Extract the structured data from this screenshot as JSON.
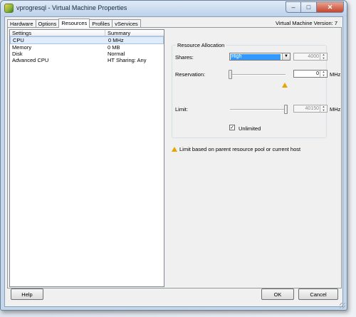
{
  "window": {
    "title": "vprogresql - Virtual Machine Properties",
    "controls": {
      "minimize": "–",
      "maximize": "□",
      "close": "✕"
    }
  },
  "tabs": [
    {
      "label": "Hardware"
    },
    {
      "label": "Options"
    },
    {
      "label": "Resources",
      "active": true
    },
    {
      "label": "Profiles"
    },
    {
      "label": "vServices"
    }
  ],
  "vm_version": "Virtual Machine Version: 7",
  "settings_list": {
    "headers": {
      "settings": "Settings",
      "summary": "Summary"
    },
    "rows": [
      {
        "setting": "CPU",
        "summary": "0 MHz",
        "selected": true
      },
      {
        "setting": "Memory",
        "summary": "0 MB"
      },
      {
        "setting": "Disk",
        "summary": "Normal"
      },
      {
        "setting": "Advanced CPU",
        "summary": "HT Sharing: Any"
      }
    ]
  },
  "resource_allocation": {
    "legend": "Resource Allocation",
    "shares": {
      "label": "Shares:",
      "selected": "High",
      "value": "4000"
    },
    "reservation": {
      "label": "Reservation:",
      "value": "0",
      "unit": "MHz"
    },
    "limit": {
      "label": "Limit:",
      "value": "40150",
      "unit": "MHz"
    },
    "unlimited": {
      "label": "Unlimited",
      "checked": true,
      "mark": "✓"
    }
  },
  "note": "Limit based on parent resource pool or current host",
  "buttons": {
    "help": "Help",
    "ok": "OK",
    "cancel": "Cancel"
  },
  "spin_arrows": {
    "up": "▲",
    "down": "▼"
  },
  "dropdown_arrow": "▼",
  "colors": {
    "selection": "#3399ff",
    "warning": "#e8a400",
    "close_button": "#c8442a"
  }
}
